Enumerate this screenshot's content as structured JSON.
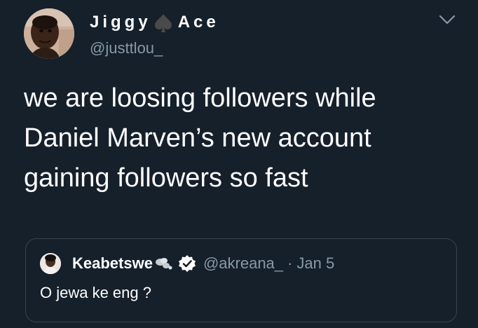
{
  "tweet": {
    "display_name_part1": "Jiggy",
    "display_name_part2": "Ace",
    "name_emoji_icon": "black-spade-icon",
    "handle": "@justtlou_",
    "text": "we are loosing followers while\nDaniel Marven’s new account\ngaining followers so fast",
    "menu_icon": "chevron-down-icon"
  },
  "quoted_tweet": {
    "name": "Keabetswe",
    "name_emoji_icon": "dashing-away-icon",
    "verified_icon": "verified-badge-icon",
    "handle": "@akreana_",
    "separator": "·",
    "date": "Jan 5",
    "text": "O jewa ke eng ?"
  },
  "colors": {
    "background": "#15202b",
    "text": "#ffffff",
    "secondary_text": "#8899a6",
    "border": "#38444d"
  }
}
